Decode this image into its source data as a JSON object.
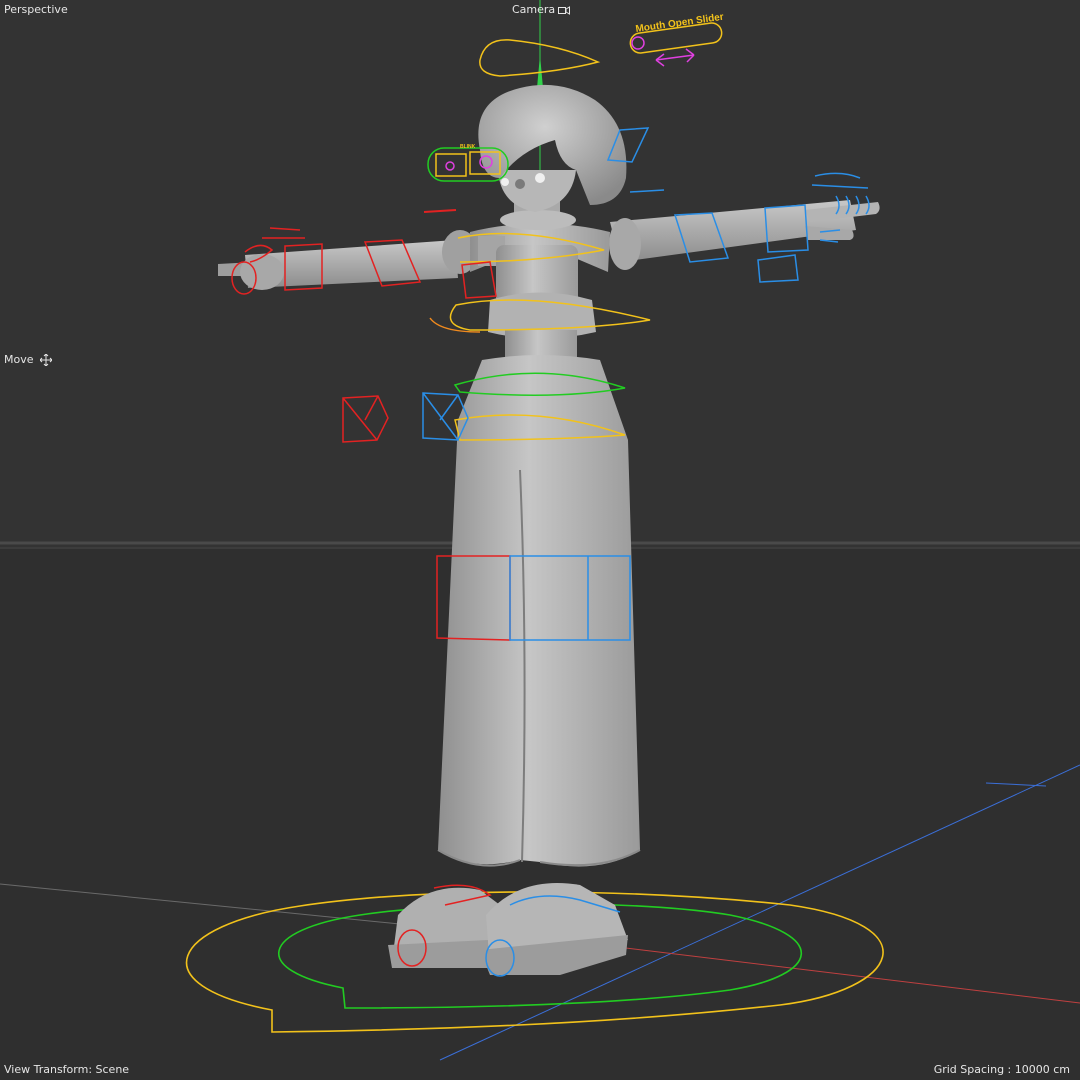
{
  "viewport": {
    "view_name": "Perspective",
    "camera_label": "Camera",
    "tool_label": "Move",
    "view_transform": "View Transform: Scene",
    "grid_spacing": "Grid Spacing : 10000 cm"
  },
  "rig_controls": {
    "mouth_slider_label": "Mouth Open Slider",
    "blink_label": "BLINK"
  },
  "icons": {
    "camera": "camera-icon",
    "move": "move-icon"
  },
  "colors": {
    "background": "#333333",
    "ground": "#2f2f2f",
    "horizon": "#4a4a4a",
    "character": "#b9b9b9",
    "control_yellow": "#f2c21b",
    "control_green": "#22cc22",
    "control_red": "#e32222",
    "control_blue": "#2a8ee6",
    "control_magenta": "#e040e0",
    "axis_green": "#31d24a",
    "axis_blue": "#3b6fd8",
    "axis_red": "#c04040"
  }
}
